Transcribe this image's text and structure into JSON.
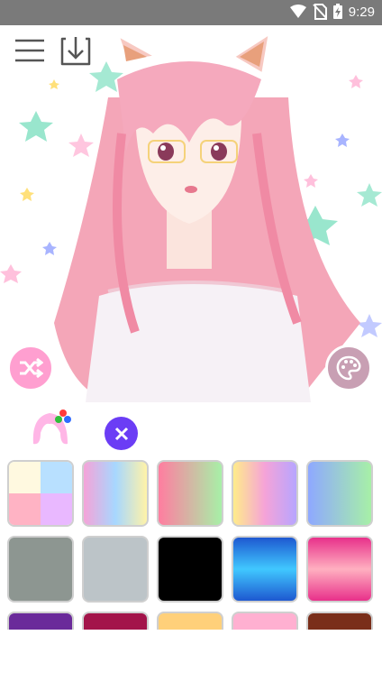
{
  "status_bar": {
    "time": "9:29",
    "icons": [
      "wifi-icon",
      "no-sim-icon",
      "battery-charging-icon"
    ]
  },
  "toolbar": {
    "icons": [
      "menu-icon",
      "download-icon"
    ]
  },
  "canvas": {
    "character": "anime-girl-preview",
    "background": "stars-pattern"
  },
  "actions": {
    "randomize_icon": "shuffle-icon",
    "palette_icon": "palette-icon"
  },
  "category": {
    "icon": "hair-color-icon",
    "clear_icon": "close-icon"
  },
  "colors": {
    "accent_pink": "#ff9fd0",
    "accent_purple": "#6b3df5",
    "swatches": [
      {
        "name": "multi-pastel"
      },
      {
        "name": "pink-blue-yellow"
      },
      {
        "name": "red-green"
      },
      {
        "name": "yellow-purple"
      },
      {
        "name": "blue-green"
      },
      {
        "name": "gray",
        "hex": "#8d9691"
      },
      {
        "name": "light-gray",
        "hex": "#bcc4c8"
      },
      {
        "name": "black",
        "hex": "#000000"
      },
      {
        "name": "blue-gradient"
      },
      {
        "name": "pink-gradient"
      },
      {
        "name": "purple",
        "hex": "#6a2a9a"
      },
      {
        "name": "crimson",
        "hex": "#a3144a"
      },
      {
        "name": "peach",
        "hex": "#ffd07a"
      },
      {
        "name": "light-pink",
        "hex": "#ffb0d1"
      },
      {
        "name": "brown",
        "hex": "#7a2e1a"
      }
    ]
  }
}
